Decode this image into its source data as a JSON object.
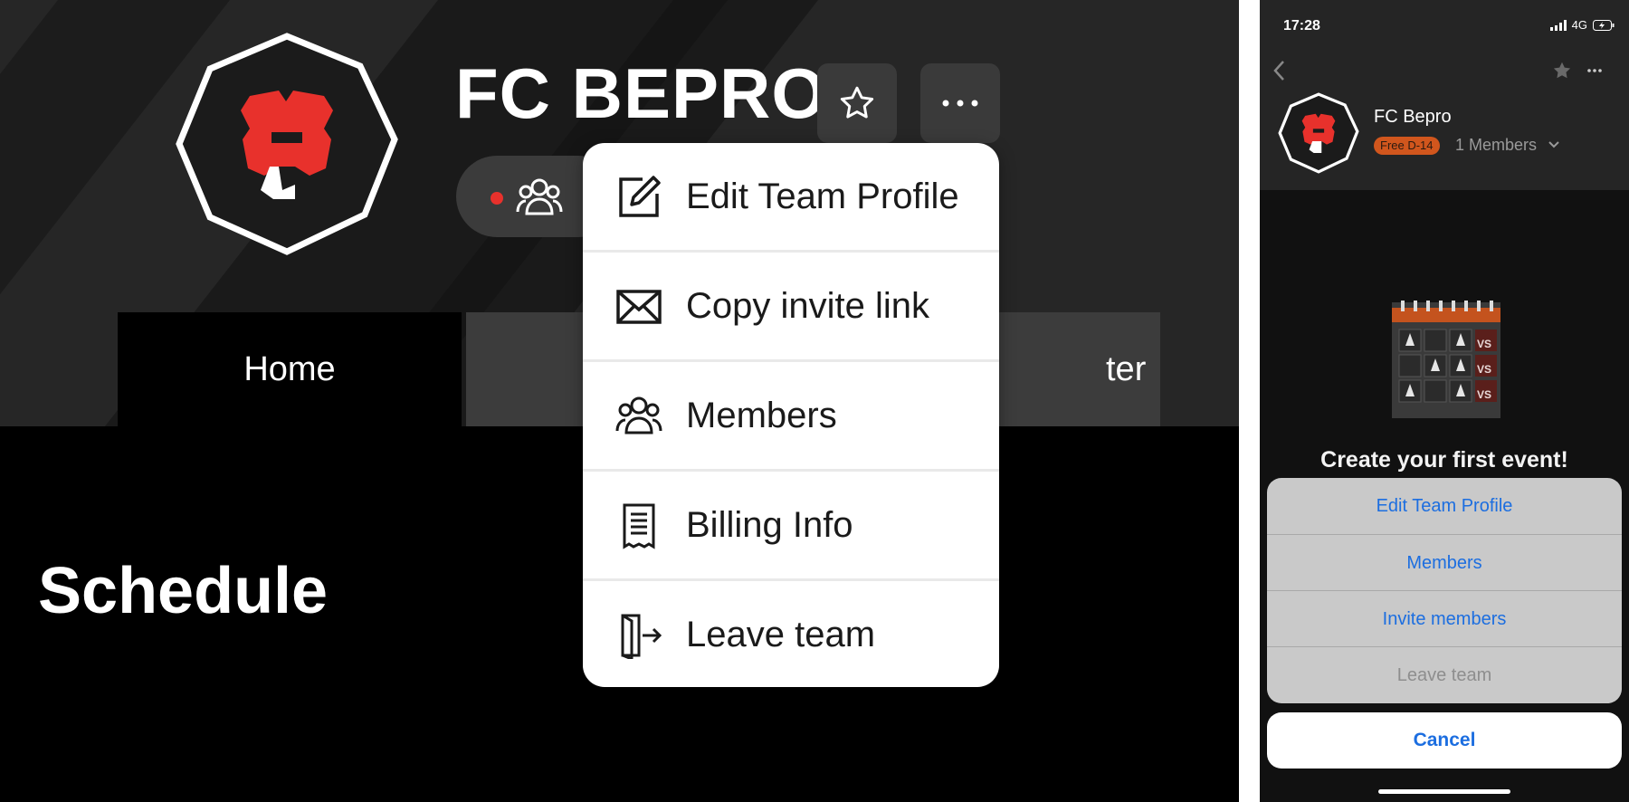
{
  "desktop": {
    "team_name": "FC BEPRO",
    "star_icon": "star-outline-icon",
    "more_icon": "more-dots-icon",
    "members_icon": "members-icon",
    "tabs": [
      {
        "label": "Home"
      },
      {
        "label": ""
      },
      {
        "label": "ter"
      }
    ],
    "section_title": "Schedule",
    "menu": [
      {
        "label": "Edit Team Profile",
        "icon": "edit-icon"
      },
      {
        "label": "Copy invite link",
        "icon": "mail-icon"
      },
      {
        "label": "Members",
        "icon": "members-icon"
      },
      {
        "label": "Billing Info",
        "icon": "receipt-icon"
      },
      {
        "label": "Leave team",
        "icon": "exit-icon"
      }
    ],
    "accent_color": "#e8312c"
  },
  "phone": {
    "status": {
      "time": "17:28",
      "network": "4G"
    },
    "team_name": "FC Bepro",
    "badge": "Free D-14",
    "members": "1 Members",
    "cta": "Create your first event!",
    "illustration_labels": [
      "VS",
      "VS",
      "VS"
    ],
    "sheet": [
      {
        "label": "Edit Team Profile"
      },
      {
        "label": "Members"
      },
      {
        "label": "Invite members"
      },
      {
        "label": "Leave team"
      }
    ],
    "cancel": "Cancel",
    "link_color": "#1c6ee0"
  }
}
